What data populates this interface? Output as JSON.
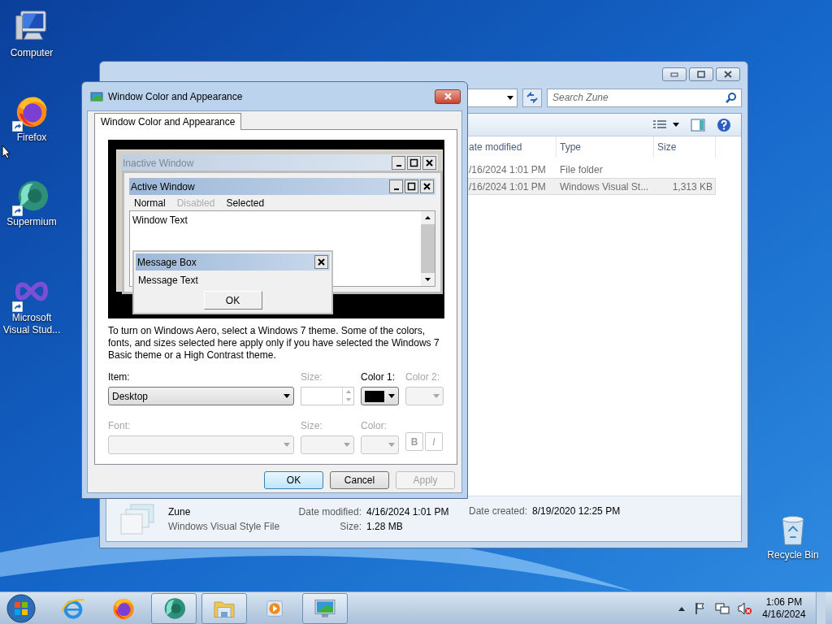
{
  "desktop_icons": [
    {
      "label": "Computer",
      "kind": "computer",
      "shortcut": false
    },
    {
      "label": "Firefox",
      "kind": "firefox",
      "shortcut": true
    },
    {
      "label": "Supermium",
      "kind": "supermium",
      "shortcut": true
    },
    {
      "label": "Microsoft Visual Stud...",
      "kind": "visual-studio",
      "shortcut": true
    }
  ],
  "recycle_bin": {
    "label": "Recycle Bin"
  },
  "explorer": {
    "search": {
      "placeholder": "Search Zune"
    },
    "columns": [
      "ate modified",
      "Type",
      "Size"
    ],
    "rows": [
      {
        "date": "/16/2024 1:01 PM",
        "type": "File folder",
        "selected": false
      },
      {
        "date": "/16/2024 1:01 PM",
        "type": "Windows Visual St...",
        "size": "1,313 KB",
        "selected": true
      }
    ],
    "details": {
      "name": "Zune",
      "type": "Windows Visual Style File",
      "fields": [
        {
          "label": "Date modified:",
          "value": "4/16/2024 1:01 PM"
        },
        {
          "label": "Size:",
          "value": "1.28 MB"
        },
        {
          "label": "Date created:",
          "value": "8/19/2020 12:25 PM"
        }
      ]
    }
  },
  "dialog": {
    "title": "Window Color and Appearance",
    "tabs": [
      {
        "label": "Window Color and Appearance",
        "selected": true
      }
    ],
    "preview": {
      "inactive_title": "Inactive Window",
      "active_title": "Active Window",
      "menu": [
        {
          "label": "Normal",
          "disabled": false
        },
        {
          "label": "Disabled",
          "disabled": true
        },
        {
          "label": "Selected",
          "disabled": false
        }
      ],
      "window_text": "Window Text",
      "message_box": {
        "title": "Message Box",
        "text": "Message Text",
        "button": "OK"
      }
    },
    "info": "To turn on Windows Aero, select a Windows 7 theme.  Some of the colors, fonts, and sizes selected here apply only if you have selected the Windows 7 Basic theme or a High Contrast theme.",
    "rows": [
      [
        {
          "label": "Item:",
          "kind": "dropdown",
          "value": "Desktop",
          "disabled": false
        },
        {
          "label": "Size:",
          "kind": "spinner",
          "disabled": true
        },
        {
          "label": "Color 1:",
          "kind": "color",
          "color": "#000000",
          "disabled": false
        },
        {
          "label": "Color 2:",
          "kind": "color",
          "disabled": true
        }
      ],
      [
        {
          "label": "Font:",
          "kind": "dropdown",
          "disabled": true
        },
        {
          "label": "Size:",
          "kind": "dropdown",
          "disabled": true
        },
        {
          "label": "Color:",
          "kind": "color",
          "disabled": true
        },
        {
          "kind": "style",
          "bold": "B",
          "italic": "I",
          "disabled": true
        }
      ]
    ],
    "buttons": [
      {
        "label": "OK",
        "default": true,
        "disabled": false
      },
      {
        "label": "Cancel",
        "default": false,
        "disabled": false
      },
      {
        "label": "Apply",
        "default": false,
        "disabled": true
      }
    ]
  },
  "taskbar": {
    "apps": [
      {
        "kind": "ie",
        "running": false
      },
      {
        "kind": "firefox",
        "running": false
      },
      {
        "kind": "supermium",
        "running": true
      },
      {
        "kind": "explorer",
        "running": true
      },
      {
        "kind": "media-player",
        "running": false
      },
      {
        "kind": "display",
        "running": true
      }
    ],
    "clock": {
      "time": "1:06 PM",
      "date": "4/16/2024"
    }
  }
}
